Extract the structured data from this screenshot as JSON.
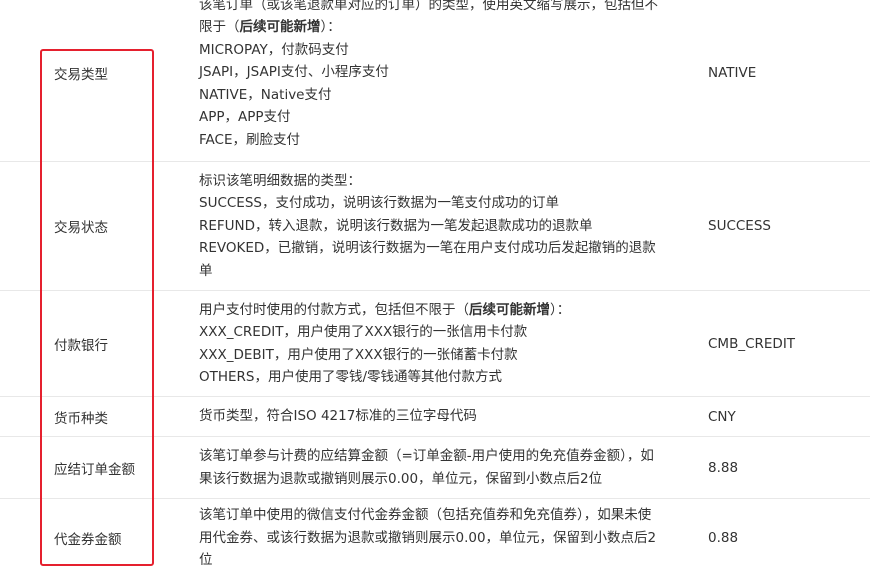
{
  "rows": [
    {
      "name": "交易类型",
      "desc_l1": "该笔订单（或该笔退款单对应的订单）的类型，使用英文缩写展示，包括但不",
      "desc_l2_pre": "限于（",
      "desc_l2_bold": "后续可能新增",
      "desc_l2_post": "）：",
      "desc_l3": "MICROPAY，付款码支付",
      "desc_l4": "JSAPI，JSAPI支付、小程序支付",
      "desc_l5": "NATIVE，Native支付",
      "desc_l6": "APP，APP支付",
      "desc_l7": "FACE，刷脸支付",
      "example": "NATIVE"
    },
    {
      "name": "交易状态",
      "desc_l1": "标识该笔明细数据的类型：",
      "desc_l2": "SUCCESS，支付成功，说明该行数据为一笔支付成功的订单",
      "desc_l3": "REFUND，转入退款，说明该行数据为一笔发起退款成功的退款单",
      "desc_l4": "REVOKED，已撤销，说明该行数据为一笔在用户支付成功后发起撤销的退款",
      "desc_l5": "单",
      "example": "SUCCESS"
    },
    {
      "name": "付款银行",
      "desc_l1_pre": "用户支付时使用的付款方式，包括但不限于（",
      "desc_l1_bold": "后续可能新增",
      "desc_l1_post": "）：",
      "desc_l2": "XXX_CREDIT，用户使用了XXX银行的一张信用卡付款",
      "desc_l3": "XXX_DEBIT，用户使用了XXX银行的一张储蓄卡付款",
      "desc_l4": "OTHERS，用户使用了零钱/零钱通等其他付款方式",
      "example": "CMB_CREDIT"
    },
    {
      "name": "货币种类",
      "desc_l1": "货币类型，符合ISO 4217标准的三位字母代码",
      "example": "CNY"
    },
    {
      "name": "应结订单金额",
      "desc_l1": "该笔订单参与计费的应结算金额（=订单金额-用户使用的免充值券金额），如",
      "desc_l2": "果该行数据为退款或撤销则展示0.00，单位元，保留到小数点后2位",
      "example": "8.88"
    },
    {
      "name": "代金券金额",
      "desc_l1": "该笔订单中使用的微信支付代金券金额（包括充值券和免充值券），如果未使",
      "desc_l2": "用代金券、或该行数据为退款或撤销则展示0.00，单位元，保留到小数点后2",
      "desc_l3": "位",
      "example": "0.88"
    }
  ],
  "colors": {
    "highlight": "#e5202e",
    "text": "#333333",
    "divider": "#e8e8e8"
  }
}
